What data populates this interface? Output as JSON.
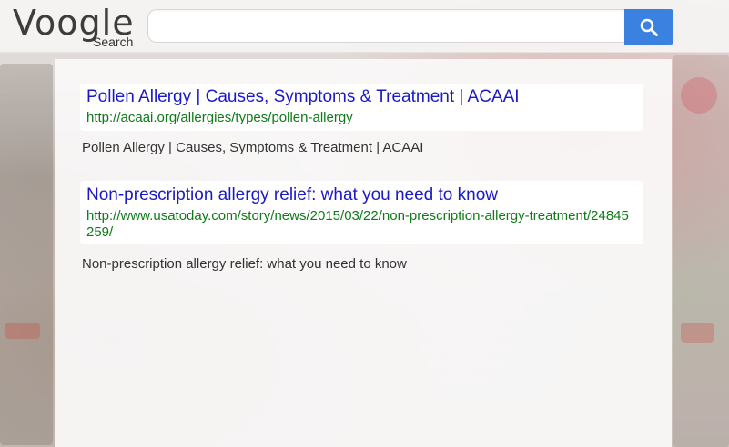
{
  "header": {
    "logo_text": "Voogle",
    "logo_subtext": "Search",
    "search_value": "",
    "search_button_icon": "search-icon"
  },
  "results": [
    {
      "title": "Pollen Allergy | Causes, Symptoms & Treatment | ACAAI",
      "url": "http://acaai.org/allergies/types/pollen-allergy",
      "snippet": "Pollen Allergy | Causes, Symptoms & Treatment | ACAAI"
    },
    {
      "title": "Non-prescription allergy relief: what you need to know",
      "url": "http://www.usatoday.com/story/news/2015/03/22/non-prescription-allergy-treatment/24845259/",
      "snippet": "Non-prescription allergy relief: what you need to know"
    }
  ],
  "colors": {
    "link_title": "#1a1ac8",
    "link_url": "#0f7a17",
    "search_button": "#3b82e0"
  }
}
